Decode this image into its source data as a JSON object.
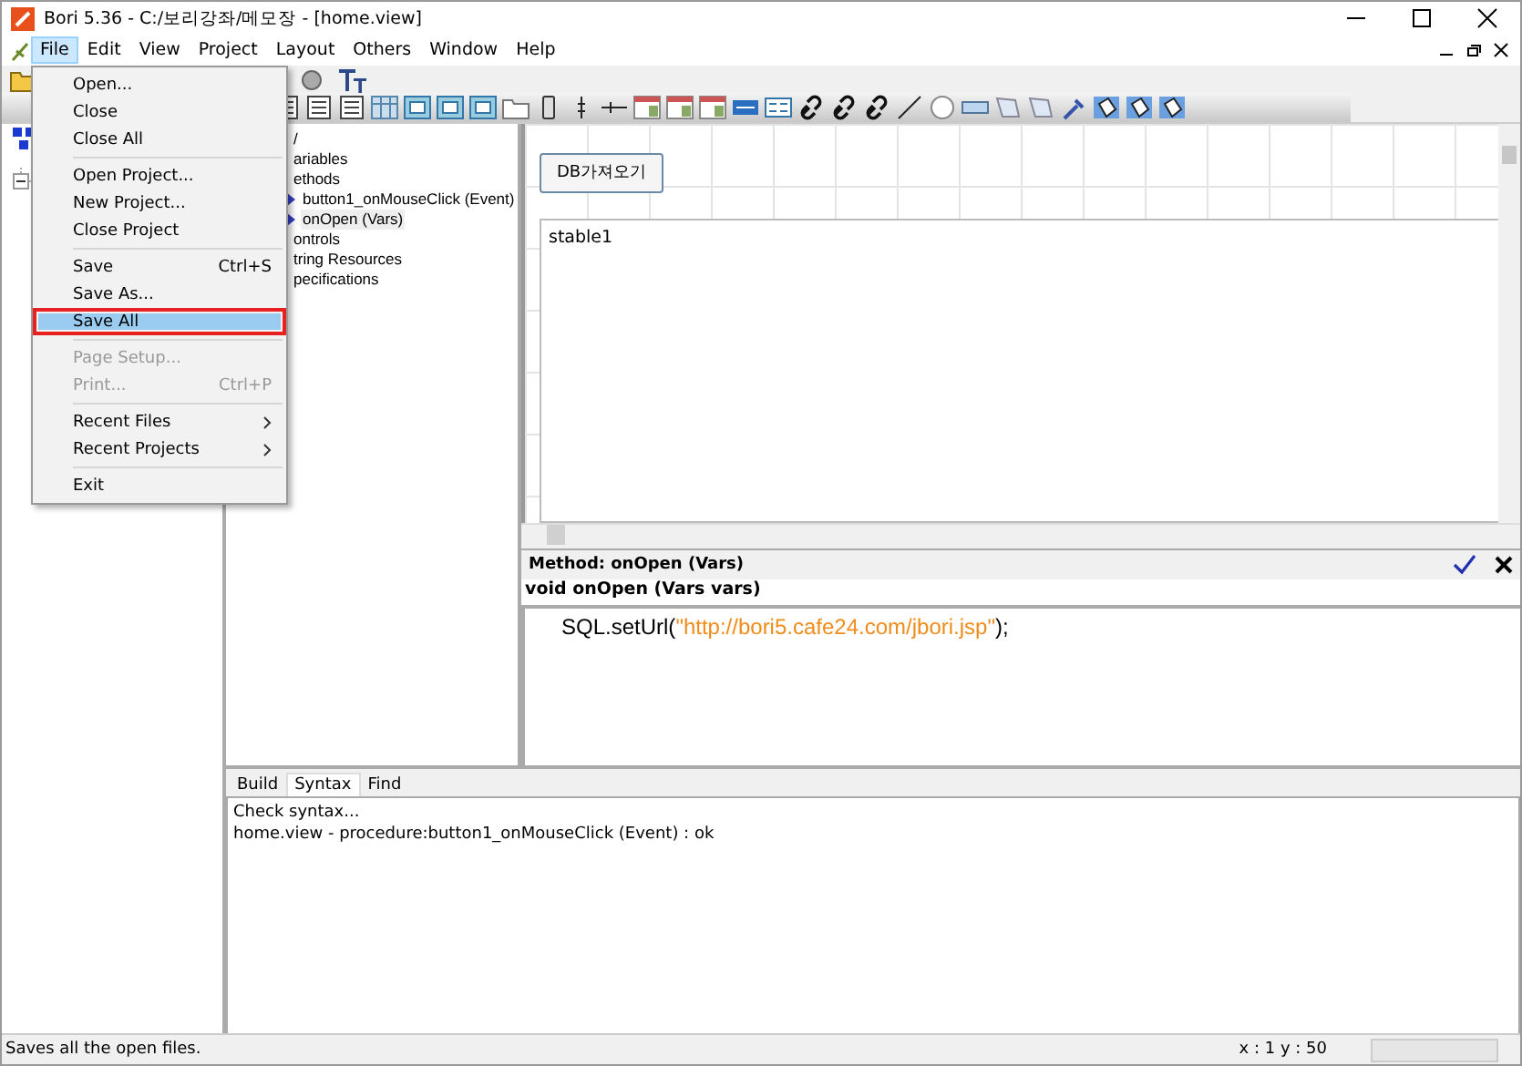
{
  "window": {
    "title": "Bori 5.36 - C:/보리강좌/메모장 - [home.view]"
  },
  "menu_bar": [
    {
      "label": "File",
      "selected": true
    },
    {
      "label": "Edit",
      "selected": false
    },
    {
      "label": "View",
      "selected": false
    },
    {
      "label": "Project",
      "selected": false
    },
    {
      "label": "Layout",
      "selected": false
    },
    {
      "label": "Others",
      "selected": false
    },
    {
      "label": "Window",
      "selected": false
    },
    {
      "label": "Help",
      "selected": false
    }
  ],
  "file_menu": {
    "items": [
      {
        "kind": "item",
        "label": "Open...",
        "selected": false,
        "disabled": false,
        "submenu": false,
        "outlined": false
      },
      {
        "kind": "item",
        "label": "Close",
        "selected": false,
        "disabled": false,
        "submenu": false,
        "outlined": false
      },
      {
        "kind": "item",
        "label": "Close All",
        "selected": false,
        "disabled": false,
        "submenu": false,
        "outlined": false
      },
      {
        "kind": "separator"
      },
      {
        "kind": "item",
        "label": "Open Project...",
        "selected": false,
        "disabled": false,
        "submenu": false,
        "outlined": false
      },
      {
        "kind": "item",
        "label": "New Project...",
        "selected": false,
        "disabled": false,
        "submenu": false,
        "outlined": false
      },
      {
        "kind": "item",
        "label": "Close Project",
        "selected": false,
        "disabled": false,
        "submenu": false,
        "outlined": false
      },
      {
        "kind": "separator"
      },
      {
        "kind": "item",
        "label": "Save",
        "shortcut": "Ctrl+S",
        "selected": false,
        "disabled": false,
        "submenu": false,
        "outlined": false
      },
      {
        "kind": "item",
        "label": "Save As...",
        "selected": false,
        "disabled": false,
        "submenu": false,
        "outlined": false
      },
      {
        "kind": "item",
        "label": "Save All",
        "selected": true,
        "disabled": false,
        "submenu": false,
        "outlined": true
      },
      {
        "kind": "separator"
      },
      {
        "kind": "item",
        "label": "Page Setup...",
        "selected": false,
        "disabled": true,
        "submenu": false,
        "outlined": false
      },
      {
        "kind": "item",
        "label": "Print...",
        "shortcut": "Ctrl+P",
        "selected": false,
        "disabled": true,
        "submenu": false,
        "outlined": false
      },
      {
        "kind": "separator"
      },
      {
        "kind": "item",
        "label": "Recent Files",
        "selected": false,
        "disabled": false,
        "submenu": true,
        "outlined": false
      },
      {
        "kind": "item",
        "label": "Recent Projects",
        "selected": false,
        "disabled": false,
        "submenu": true,
        "outlined": false
      },
      {
        "kind": "separator"
      },
      {
        "kind": "item",
        "label": "Exit",
        "selected": false,
        "disabled": false,
        "submenu": false,
        "outlined": false
      }
    ]
  },
  "tree": [
    {
      "label": "/",
      "selected": false
    },
    {
      "label": "ariables",
      "selected": false
    },
    {
      "label": "ethods",
      "selected": false,
      "children": [
        {
          "label": "button1_onMouseClick (Event)",
          "selected": false
        },
        {
          "label": "onOpen (Vars)",
          "selected": true
        }
      ]
    },
    {
      "label": "ontrols",
      "selected": false
    },
    {
      "label": "tring Resources",
      "selected": false
    },
    {
      "label": "pecifications",
      "selected": false
    }
  ],
  "canvas": {
    "button": "DB가져오기",
    "table": "stable1"
  },
  "method": {
    "title": "Method: onOpen (Vars)",
    "signature": "void onOpen (Vars vars)",
    "code": [
      {
        "kind": "plain",
        "text": "SQL.setUrl("
      },
      {
        "kind": "string",
        "text": "\"http://bori5.cafe24.com/jbori.jsp\""
      },
      {
        "kind": "plain",
        "text": ");"
      }
    ]
  },
  "output": {
    "tabs": [
      {
        "label": "Build",
        "selected": false
      },
      {
        "label": "Syntax",
        "selected": true
      },
      {
        "label": "Find",
        "selected": false
      }
    ],
    "lines": [
      "Check syntax...",
      "home.view - procedure:button1_onMouseClick (Event) : ok"
    ]
  },
  "status_bar": {
    "message": "Saves all the open files.",
    "position": "x : 1  y : 50"
  }
}
